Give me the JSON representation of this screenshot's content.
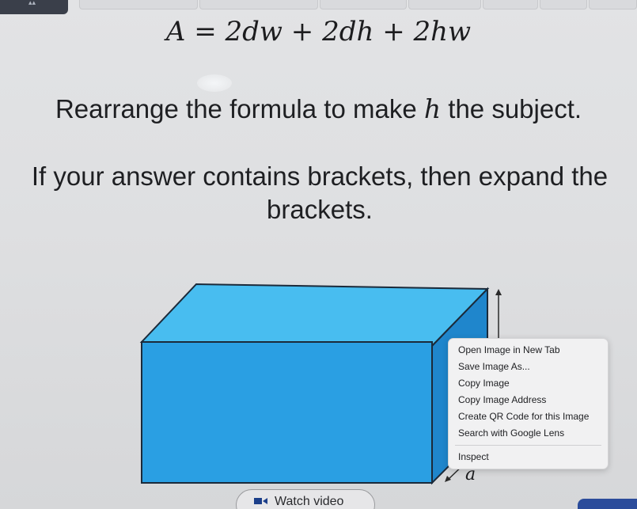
{
  "question": {
    "formula": "A = 2dw + 2dh + 2hw",
    "instruction_before": "Rearrange the formula to make ",
    "instruction_var": "h",
    "instruction_after": " the subject.",
    "note": "If your answer contains brackets, then expand the brackets."
  },
  "diagram": {
    "label_a": "a",
    "colors": {
      "front": "#2a9fe3",
      "top": "#48bdf0",
      "side": "#1f86cc",
      "edge": "#1b2a3a"
    }
  },
  "context_menu": {
    "items": [
      "Open Image in New Tab",
      "Save Image As...",
      "Copy Image",
      "Copy Image Address",
      "Create QR Code for this Image",
      "Search with Google Lens"
    ],
    "inspect": "Inspect"
  },
  "video_button": {
    "label": "Watch video"
  }
}
